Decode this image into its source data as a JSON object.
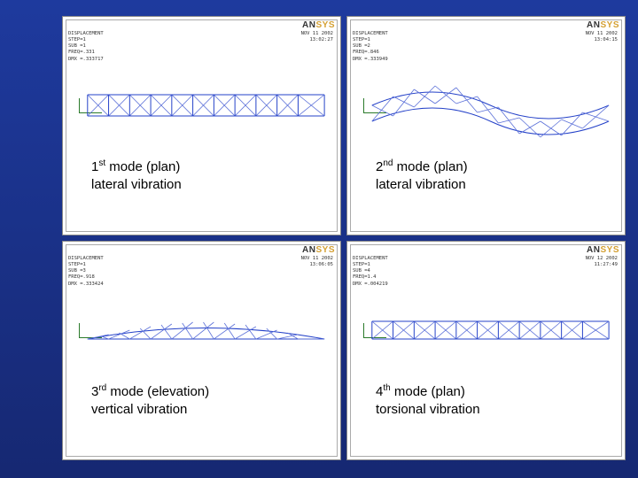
{
  "logo": {
    "left": "AN",
    "right": "SYS"
  },
  "panels": [
    {
      "meta_left": "DISPLACEMENT\nSTEP=1\nSUB =1\nFREQ=.331\nDMX =.333717",
      "meta_right": "NOV 11 2002\n13:02:27",
      "caption_num": "1",
      "caption_ord": "st",
      "caption_line1_rest": " mode (plan)",
      "caption_line2": "lateral vibration"
    },
    {
      "meta_left": "DISPLACEMENT\nSTEP=1\nSUB =2\nFREQ=.846\nDMX =.333949",
      "meta_right": "NOV 11 2002\n13:04:15",
      "caption_num": "2",
      "caption_ord": "nd",
      "caption_line1_rest": " mode (plan)",
      "caption_line2": "lateral vibration"
    },
    {
      "meta_left": "DISPLACEMENT\nSTEP=1\nSUB =3\nFREQ=.918\nDMX =.333424",
      "meta_right": "NOV 11 2002\n13:06:05",
      "caption_num": "3",
      "caption_ord": "rd",
      "caption_line1_rest": " mode (elevation)",
      "caption_line2": "vertical vibration"
    },
    {
      "meta_left": "DISPLACEMENT\nSTEP=1\nSUB =4\nFREQ=1.4\nDMX =.004219",
      "meta_right": "NOV 12 2002\n11:27:49",
      "caption_num": "4",
      "caption_ord": "th",
      "caption_line1_rest": " mode (plan)",
      "caption_line2": "torsional vibration"
    }
  ]
}
